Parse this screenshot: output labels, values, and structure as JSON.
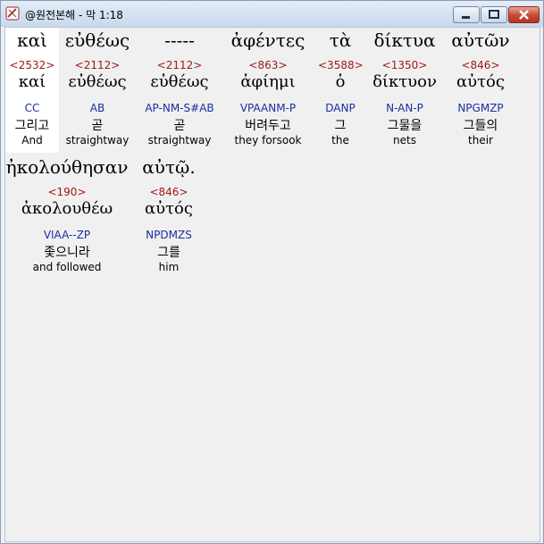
{
  "window": {
    "title": "@원전본해 - 막 1:18"
  },
  "rows": [
    [
      {
        "greek": "καὶ",
        "strong": "<2532>",
        "lemma": "καί",
        "morph": "CC",
        "korean": "그리고",
        "english": "And"
      },
      {
        "greek": "εὐθέως",
        "strong": "<2112>",
        "lemma": "εὐθέως",
        "morph": "AB",
        "korean": "곧",
        "english": "straightway"
      },
      {
        "greek": "-----",
        "strong": "<2112>",
        "lemma": "εὐθέως",
        "morph": "AP-NM-S#AB",
        "korean": "곧",
        "english": "straightway"
      },
      {
        "greek": "ἀφέντες",
        "strong": "<863>",
        "lemma": "ἀφίημι",
        "morph": "VPAANM-P",
        "korean": "버려두고",
        "english": "they forsook"
      },
      {
        "greek": "τὰ",
        "strong": "<3588>",
        "lemma": "ὁ",
        "morph": "DANP",
        "korean": "그",
        "english": "the"
      },
      {
        "greek": "δίκτυα",
        "strong": "<1350>",
        "lemma": "δίκτυον",
        "morph": "N-AN-P",
        "korean": "그물을",
        "english": "nets"
      },
      {
        "greek": "αὐτῶν",
        "strong": "<846>",
        "lemma": "αὐτός",
        "morph": "NPGMZP",
        "korean": "그들의",
        "english": "their"
      }
    ],
    [
      {
        "greek": "ἠκολούθησαν",
        "strong": "<190>",
        "lemma": "ἀκολουθέω",
        "morph": "VIAA--ZP",
        "korean": "좇으니라",
        "english": "and followed"
      },
      {
        "greek": "αὐτῷ.",
        "strong": "<846>",
        "lemma": "αὐτός",
        "morph": "NPDMZS",
        "korean": "그를",
        "english": "him"
      }
    ]
  ]
}
